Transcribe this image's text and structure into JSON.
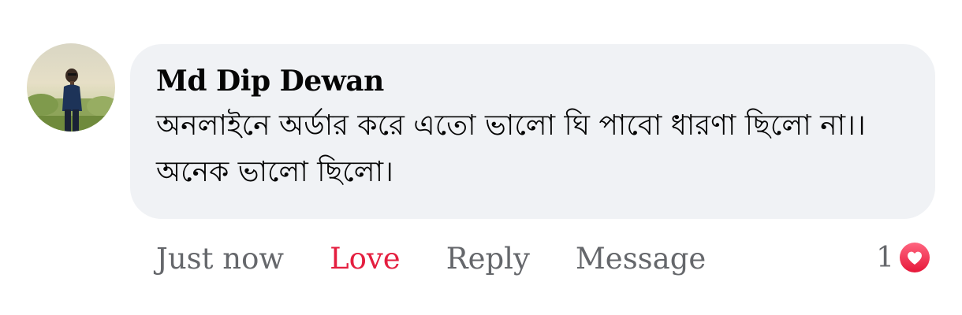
{
  "comment": {
    "author": "Md Dip Dewan",
    "text": "অনলাইনে অর্ডার করে এতো ভালো ঘি পাবো ধারণা ছিলো না।। অনেক ভালো ছিলো।",
    "timestamp": "Just now",
    "actions": {
      "love_label": "Love",
      "reply_label": "Reply",
      "message_label": "Message"
    },
    "reactions": {
      "count": "1",
      "icon": "heart-icon"
    }
  },
  "colors": {
    "bubble": "#f0f2f5",
    "love": "#e41e3f",
    "secondary_text": "#65676b"
  }
}
